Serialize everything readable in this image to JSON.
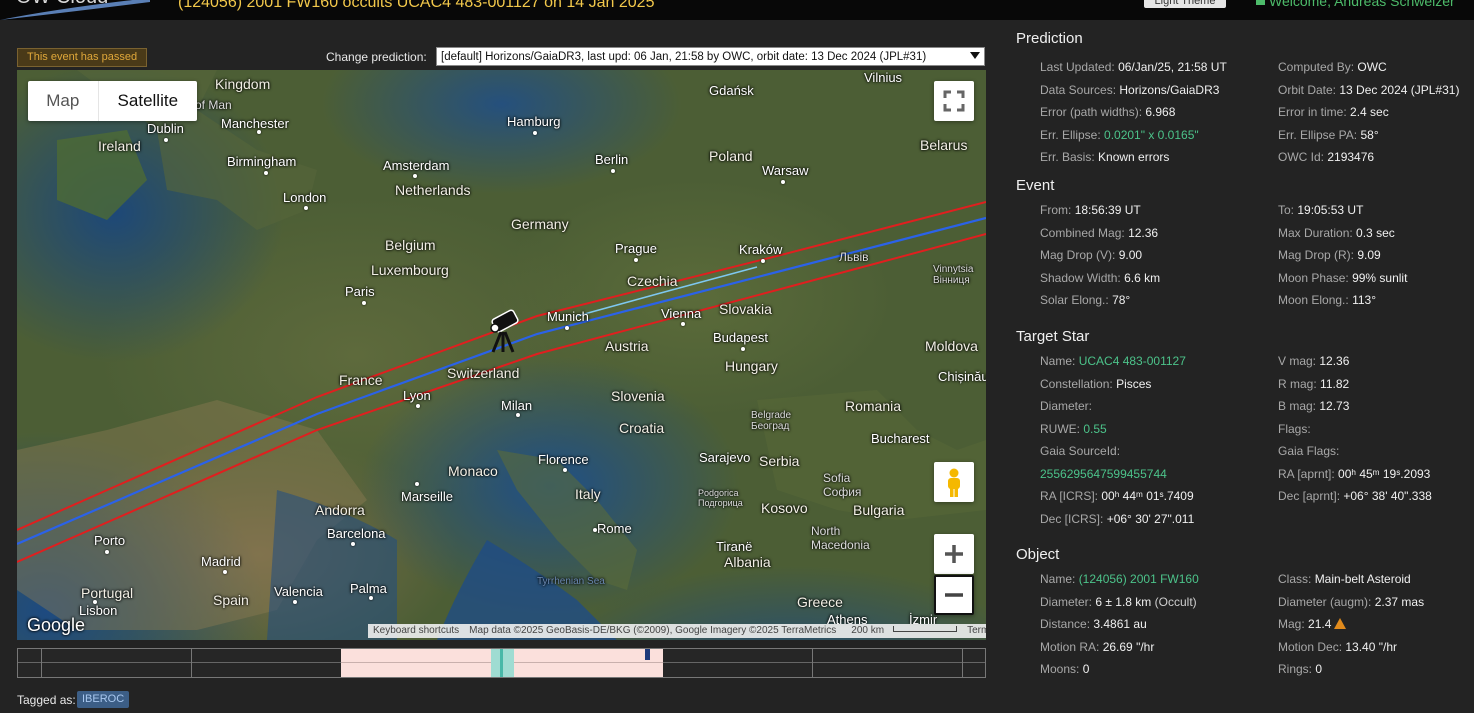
{
  "header": {
    "logo_text": "OW Cloud",
    "event_title": "(124056) 2001 FW160 occults UCAC4 483-001127 on 14 Jan 2025",
    "theme_button": "Light Theme",
    "welcome": "Welcome, Andreas Schweizer"
  },
  "event_status": "This event has passed",
  "change_prediction": {
    "label": "Change prediction:",
    "selected": "[default] Horizons/GaiaDR3, last upd: 06 Jan, 21:58 by OWC, orbit date: 13 Dec 2024 (JPL#31)"
  },
  "map": {
    "type_buttons": {
      "map": "Map",
      "satellite": "Satellite"
    },
    "selected_type": "Satellite",
    "places": {
      "kingdom": "Kingdom",
      "of_man": "of Man",
      "dublin": "Dublin",
      "manchester": "Manchester",
      "ireland": "Ireland",
      "birmingham": "Birmingham",
      "london": "London",
      "amsterdam": "Amsterdam",
      "netherlands": "Netherlands",
      "hamburg": "Hamburg",
      "gdansk": "Gdańsk",
      "vilnius": "Vilnius",
      "berlin": "Berlin",
      "poland": "Poland",
      "warsaw": "Warsaw",
      "belarus": "Belarus",
      "germany": "Germany",
      "belgium": "Belgium",
      "luxembourg": "Luxembourg",
      "prague": "Prague",
      "krakow": "Kraków",
      "lviv": "Львів",
      "vinnytsia": "Vinnytsia\nВінниця",
      "paris": "Paris",
      "czechia": "Czechia",
      "slovakia": "Slovakia",
      "munich": "Munich",
      "vienna": "Vienna",
      "budapest": "Budapest",
      "austria": "Austria",
      "moldova": "Moldova",
      "chisinau": "Chișinău",
      "france": "France",
      "switzerland": "Switzerland",
      "hungary": "Hungary",
      "lyon": "Lyon",
      "milan": "Milan",
      "slovenia": "Slovenia",
      "belgrade": "Belgrade\nБеоград",
      "romania": "Romania",
      "croatia": "Croatia",
      "bucharest": "Bucharest",
      "monaco": "Monaco",
      "florence": "Florence",
      "sarajevo": "Sarajevo",
      "serbia": "Serbia",
      "sofia": "Sofia\nСофия",
      "marseille": "Marseille",
      "italy": "Italy",
      "podgorica": "Podgorica\nПодгорица",
      "kosovo": "Kosovo",
      "bulgaria": "Bulgaria",
      "andorra": "Andorra",
      "rome": "Rome",
      "north_macedonia": "North\nMacedonia",
      "porto": "Porto",
      "barcelona": "Barcelona",
      "tirane": "Tiranë",
      "albania": "Albania",
      "madrid": "Madrid",
      "portugal": "Portugal",
      "palma": "Palma",
      "valencia": "Valencia",
      "spain": "Spain",
      "tyrrhenian": "Tyrrhenian Sea",
      "greece": "Greece",
      "lisbon": "Lisbon",
      "athens": "Athens",
      "izmir": "İzmir"
    },
    "google": "Google",
    "footer": {
      "shortcuts": "Keyboard shortcuts",
      "attribution": "Map data ©2025 GeoBasis-DE/BKG (©2009), Google Imagery ©2025 TerraMetrics",
      "scale": "200 km",
      "terms": "Terms"
    },
    "colors": {
      "path_center": "#2b62e8",
      "path_limits": "#e01f1f",
      "center_highlight": "#7ec8f0"
    }
  },
  "tagged": {
    "label": "Tagged as:",
    "tag": "IBEROC"
  },
  "prediction": {
    "title": "Prediction",
    "last_updated": {
      "label": "Last Updated:",
      "value": "06/Jan/25, 21:58 UT"
    },
    "computed_by": {
      "label": "Computed By:",
      "value": "OWC"
    },
    "data_sources": {
      "label": "Data Sources:",
      "value": "Horizons/GaiaDR3"
    },
    "orbit_date": {
      "label": "Orbit Date:",
      "value": "13 Dec 2024 (JPL#31)"
    },
    "error_path": {
      "label": "Error (path widths):",
      "value": "6.968"
    },
    "error_time": {
      "label": "Error in time:",
      "value": "2.4 sec"
    },
    "err_ellipse": {
      "label": "Err. Ellipse:",
      "value": "0.0201\" x 0.0165\""
    },
    "err_ellipse_pa": {
      "label": "Err. Ellipse PA:",
      "value": "58°"
    },
    "err_basis": {
      "label": "Err. Basis:",
      "value": "Known errors"
    },
    "owc_id": {
      "label": "OWC Id:",
      "value": "2193476"
    }
  },
  "event": {
    "title": "Event",
    "from": {
      "label": "From:",
      "value": "18:56:39 UT"
    },
    "to": {
      "label": "To:",
      "value": "19:05:53 UT"
    },
    "combined_mag": {
      "label": "Combined Mag:",
      "value": "12.36"
    },
    "max_duration": {
      "label": "Max Duration:",
      "value": "0.3 sec"
    },
    "mag_drop_v": {
      "label": "Mag Drop (V):",
      "value": "9.00"
    },
    "mag_drop_r": {
      "label": "Mag Drop (R):",
      "value": "9.09"
    },
    "shadow_width": {
      "label": "Shadow Width:",
      "value": "6.6 km"
    },
    "moon_phase": {
      "label": "Moon Phase:",
      "value": "99% sunlit"
    },
    "solar_elong": {
      "label": "Solar Elong.:",
      "value": "78°"
    },
    "moon_elong": {
      "label": "Moon Elong.:",
      "value": "113°"
    }
  },
  "target_star": {
    "title": "Target Star",
    "name": {
      "label": "Name:",
      "value": "UCAC4 483-001127"
    },
    "v_mag": {
      "label": "V mag:",
      "value": "12.36"
    },
    "constellation": {
      "label": "Constellation:",
      "value": "Pisces"
    },
    "r_mag": {
      "label": "R mag:",
      "value": "11.82"
    },
    "diameter": {
      "label": "Diameter:",
      "value": ""
    },
    "b_mag": {
      "label": "B mag:",
      "value": "12.73"
    },
    "ruwe": {
      "label": "RUWE:",
      "value": "0.55"
    },
    "flags": {
      "label": "Flags:",
      "value": ""
    },
    "gaia_source_id": {
      "label": "Gaia SourceId:",
      "value": "2556295647599455744"
    },
    "gaia_flags": {
      "label": "Gaia Flags:",
      "value": ""
    },
    "ra_aprnt": {
      "label": "RA [aprnt]:",
      "value": "00ʰ 45ᵐ 19ˢ.2093"
    },
    "ra_icrs": {
      "label": "RA [ICRS]:",
      "value": "00ʰ 44ᵐ 01ˢ.7409"
    },
    "dec_aprnt": {
      "label": "Dec [aprnt]:",
      "value": "+06° 38' 40\".338"
    },
    "dec_icrs": {
      "label": "Dec [ICRS]:",
      "value": "+06° 30' 27\".011"
    }
  },
  "object": {
    "title": "Object",
    "name": {
      "label": "Name:",
      "value": "(124056) 2001 FW160"
    },
    "class": {
      "label": "Class:",
      "value": "Main-belt Asteroid"
    },
    "diameter": {
      "label": "Diameter:",
      "value": "6 ± 1.8 km",
      "extra": "(Occult)"
    },
    "diameter_augm": {
      "label": "Diameter (augm):",
      "value": "2.37 mas"
    },
    "distance": {
      "label": "Distance:",
      "value": "3.4861 au"
    },
    "mag": {
      "label": "Mag:",
      "value": "21.4"
    },
    "motion_ra": {
      "label": "Motion RA:",
      "value": "26.69 \"/hr"
    },
    "motion_dec": {
      "label": "Motion Dec:",
      "value": "13.40 \"/hr"
    },
    "moons": {
      "label": "Moons:",
      "value": "0"
    },
    "rings": {
      "label": "Rings:",
      "value": "0"
    }
  }
}
